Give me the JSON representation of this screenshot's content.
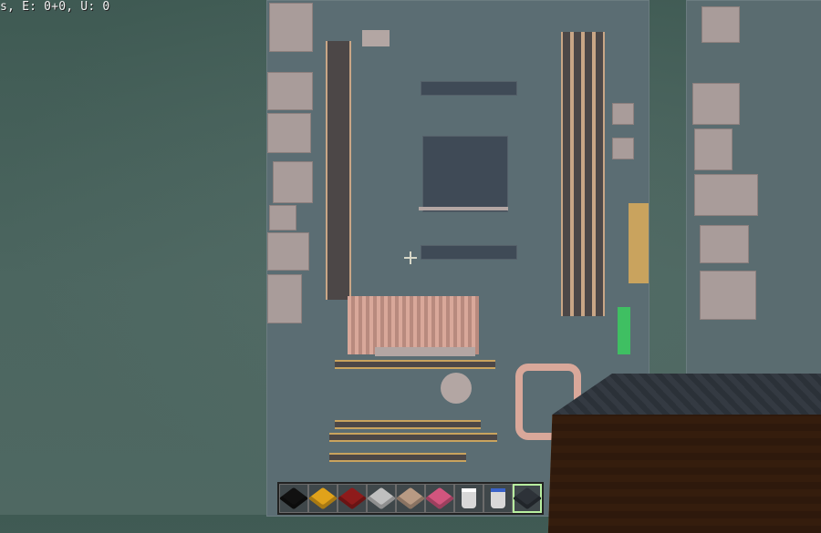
{
  "hud": {
    "debug_text": "s, E: 0+0, U: 0"
  },
  "hotbar": {
    "selected_index": 8,
    "slots": [
      {
        "item": "black-block",
        "color": "#111111"
      },
      {
        "item": "yellow-block",
        "color": "#e0a21a"
      },
      {
        "item": "red-block",
        "color": "#8e1b1b"
      },
      {
        "item": "light-gray-block",
        "color": "#bfbfbf"
      },
      {
        "item": "tan-block",
        "color": "#b89a83"
      },
      {
        "item": "pink-block",
        "color": "#d2557e"
      },
      {
        "item": "bucket-white",
        "color": "#e8e8e8"
      },
      {
        "item": "bucket-water",
        "color": "#3a63c9"
      },
      {
        "item": "dark-block",
        "color": "#2d3238"
      }
    ]
  },
  "colors": {
    "board": "#5b6d73",
    "copper": "#d9a89a",
    "gold_trace": "#c9a35e",
    "sky_fog": "#4c6660"
  }
}
